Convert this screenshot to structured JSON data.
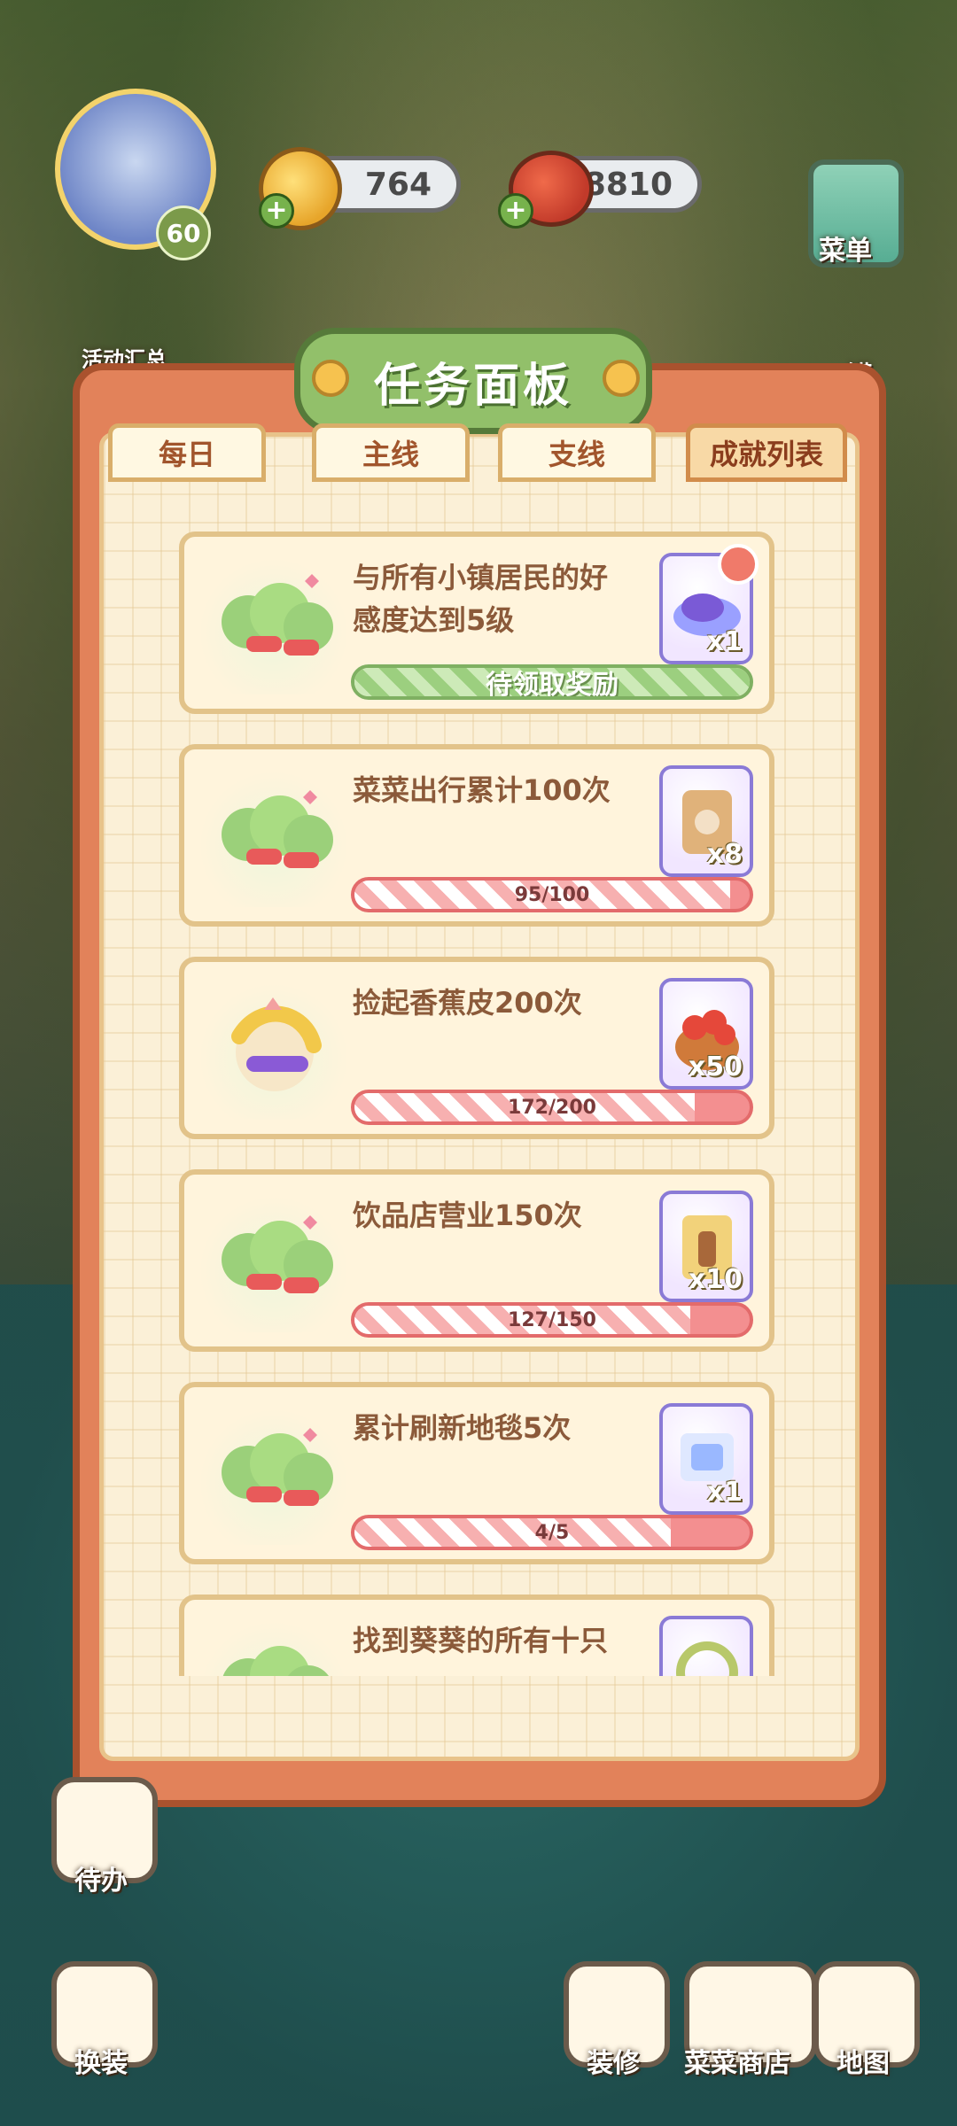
{
  "hud": {
    "level": "60",
    "coins": "764",
    "tomatoes": "8810",
    "menu_label": "菜单",
    "activity_label": "活动汇总",
    "right_label": "罐"
  },
  "panel": {
    "title": "任务面板",
    "tabs": [
      "每日",
      "主线",
      "支线",
      "成就列表"
    ],
    "active_tab": "成就列表"
  },
  "tasks": [
    {
      "title_line1": "与所有小镇居民的好",
      "title_line2": "感度达到5级",
      "reward_qty": "x1",
      "progress_text": "待领取奖励",
      "progress": 1.0,
      "status": "claimable"
    },
    {
      "title_line1": "菜菜出行累计100次",
      "title_line2": "",
      "reward_qty": "x8",
      "progress_text": "95/100",
      "progress": 0.95,
      "status": "in_progress"
    },
    {
      "title_line1": "捡起香蕉皮200次",
      "title_line2": "",
      "reward_qty": "x50",
      "progress_text": "172/200",
      "progress": 0.86,
      "status": "in_progress"
    },
    {
      "title_line1": "饮品店营业150次",
      "title_line2": "",
      "reward_qty": "x10",
      "progress_text": "127/150",
      "progress": 0.85,
      "status": "in_progress"
    },
    {
      "title_line1": "累计刷新地毯5次",
      "title_line2": "",
      "reward_qty": "x1",
      "progress_text": "4/5",
      "progress": 0.8,
      "status": "in_progress"
    },
    {
      "title_line1": "找到葵葵的所有十只",
      "title_line2": "",
      "reward_qty": "",
      "progress_text": "",
      "progress": 0.0,
      "status": "partial"
    }
  ],
  "bottom": {
    "todo": "待办",
    "dress": "换装",
    "decorate": "装修",
    "shop": "菜菜商店",
    "map": "地图"
  },
  "colors": {
    "panel_orange": "#e2825a",
    "panel_border": "#a9522e",
    "title_green": "#92c06a",
    "tab_text": "#a1552c",
    "progress_red": "#f38f90",
    "progress_green": "#a7d48f"
  }
}
